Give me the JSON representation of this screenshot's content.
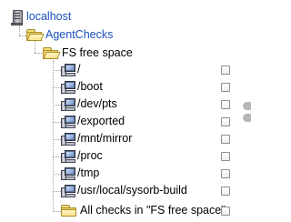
{
  "tree": {
    "root": {
      "label": "localhost",
      "icon": "server-icon"
    },
    "group": {
      "label": "AgentChecks",
      "icon": "folder-open-icon"
    },
    "category": {
      "label": "FS free space",
      "icon": "folder-open-icon"
    },
    "checks": [
      {
        "label": "/",
        "icon": "computer-check-icon",
        "checked": false
      },
      {
        "label": "/boot",
        "icon": "computer-check-icon",
        "checked": false
      },
      {
        "label": "/dev/pts",
        "icon": "computer-check-icon",
        "checked": false
      },
      {
        "label": "/exported",
        "icon": "computer-check-icon",
        "checked": false
      },
      {
        "label": "/mnt/mirror",
        "icon": "computer-check-icon",
        "checked": false
      },
      {
        "label": "/proc",
        "icon": "computer-check-icon",
        "checked": false
      },
      {
        "label": "/tmp",
        "icon": "computer-check-icon",
        "checked": false
      },
      {
        "label": "/usr/local/sysorb-build",
        "icon": "computer-check-icon",
        "checked": false
      }
    ],
    "all_checks": {
      "label": "All checks in \"FS free space\"",
      "icon": "folder-icon",
      "checked": false
    }
  },
  "colors": {
    "link": "#1a4fbd",
    "guide_lines": "#a0a0a0",
    "folder": "#f0d264"
  }
}
